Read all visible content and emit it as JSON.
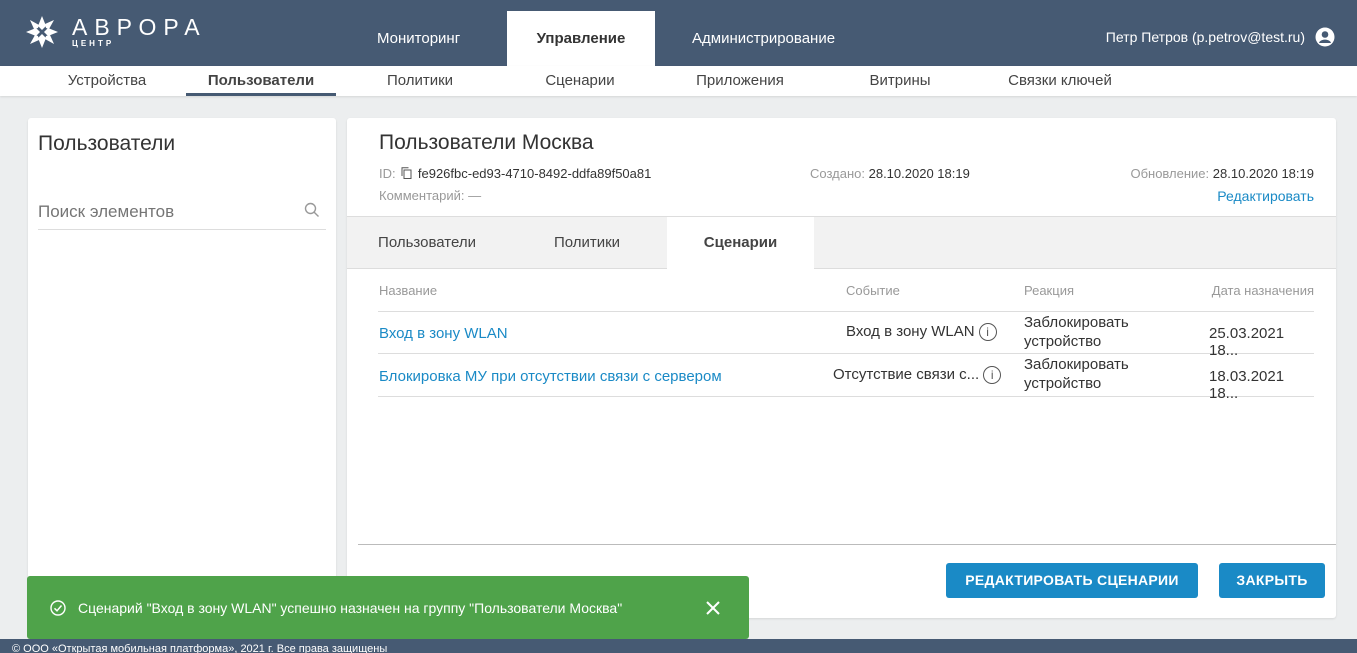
{
  "header": {
    "logo_name": "АВРОРА",
    "logo_sub": "ЦЕНТР",
    "main_tabs": [
      "Мониторинг",
      "Управление",
      "Администрирование"
    ],
    "user": "Петр Петров (p.petrov@test.ru)"
  },
  "subnav": [
    "Устройства",
    "Пользователи",
    "Политики",
    "Сценарии",
    "Приложения",
    "Витрины",
    "Связки ключей"
  ],
  "left": {
    "title": "Пользователи",
    "search_placeholder": "Поиск элементов"
  },
  "group": {
    "title": "Пользователи Москва",
    "id_label": "ID:",
    "id_value": "fe926fbc-ed93-4710-8492-ddfa89f50a81",
    "comment_label": "Комментарий:",
    "comment_value": "—",
    "created_label": "Создано:",
    "created_value": "28.10.2020 18:19",
    "updated_label": "Обновление:",
    "updated_value": "28.10.2020 18:19",
    "edit_link": "Редактировать"
  },
  "tabs": [
    "Пользователи",
    "Политики",
    "Сценарии"
  ],
  "table": {
    "columns": [
      "Название",
      "Событие",
      "Реакция",
      "Дата назначения"
    ],
    "rows": [
      {
        "name": "Вход в зону WLAN",
        "event": "Вход в зону WLAN",
        "reaction_line1": "Заблокировать",
        "reaction_line2": "устройство",
        "date": "25.03.2021 18..."
      },
      {
        "name": "Блокировка МУ при отсутствии связи с сервером",
        "event": "Отсутствие связи с...",
        "reaction_line1": "Заблокировать",
        "reaction_line2": "устройство",
        "date": "18.03.2021 18..."
      }
    ]
  },
  "buttons": {
    "edit_scenarios": "РЕДАКТИРОВАТЬ СЦЕНАРИИ",
    "close": "ЗАКРЫТЬ"
  },
  "toast": {
    "message": "Сценарий \"Вход в зону WLAN\" успешно назначен на группу \"Пользователи Москва\""
  },
  "footer": "© ООО «Открытая мобильная платформа», 2021 г. Все права защищены",
  "colors": {
    "header_bg": "#465a73",
    "accent": "#1a8ac6",
    "toast_bg": "#4fa34a"
  }
}
